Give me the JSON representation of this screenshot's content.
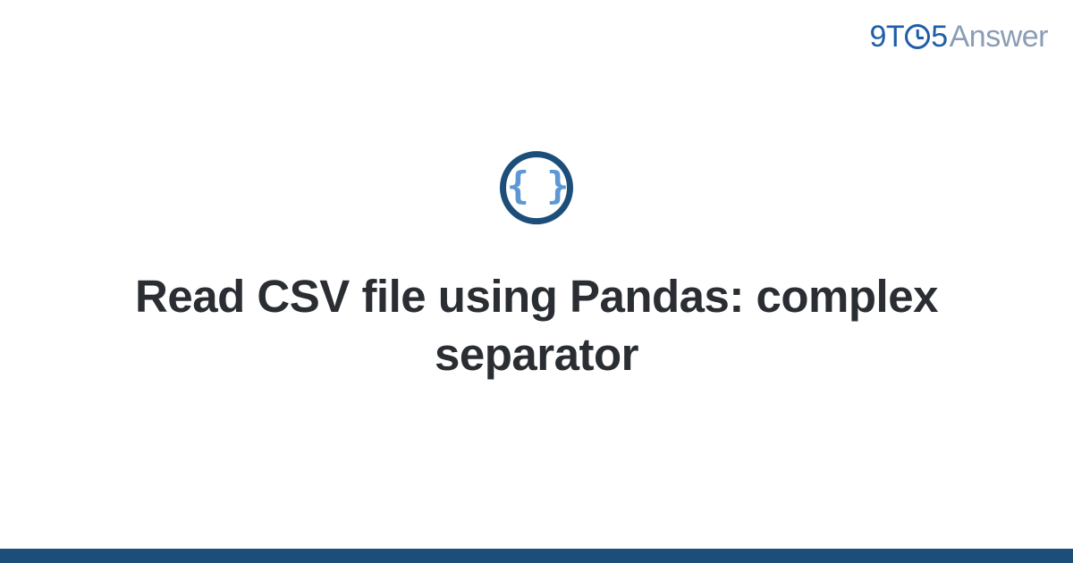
{
  "logo": {
    "part1": "9T",
    "part2": "5",
    "part3": "Answer"
  },
  "icon": {
    "name": "code-braces-icon",
    "glyph": "{ }"
  },
  "title": "Read CSV file using Pandas: complex separator",
  "colors": {
    "brand_dark": "#1d4e7a",
    "brand_blue": "#1e5ea8",
    "brand_light": "#5c98d4",
    "logo_gray": "#8a9db5",
    "text_dark": "#2a2e33"
  }
}
